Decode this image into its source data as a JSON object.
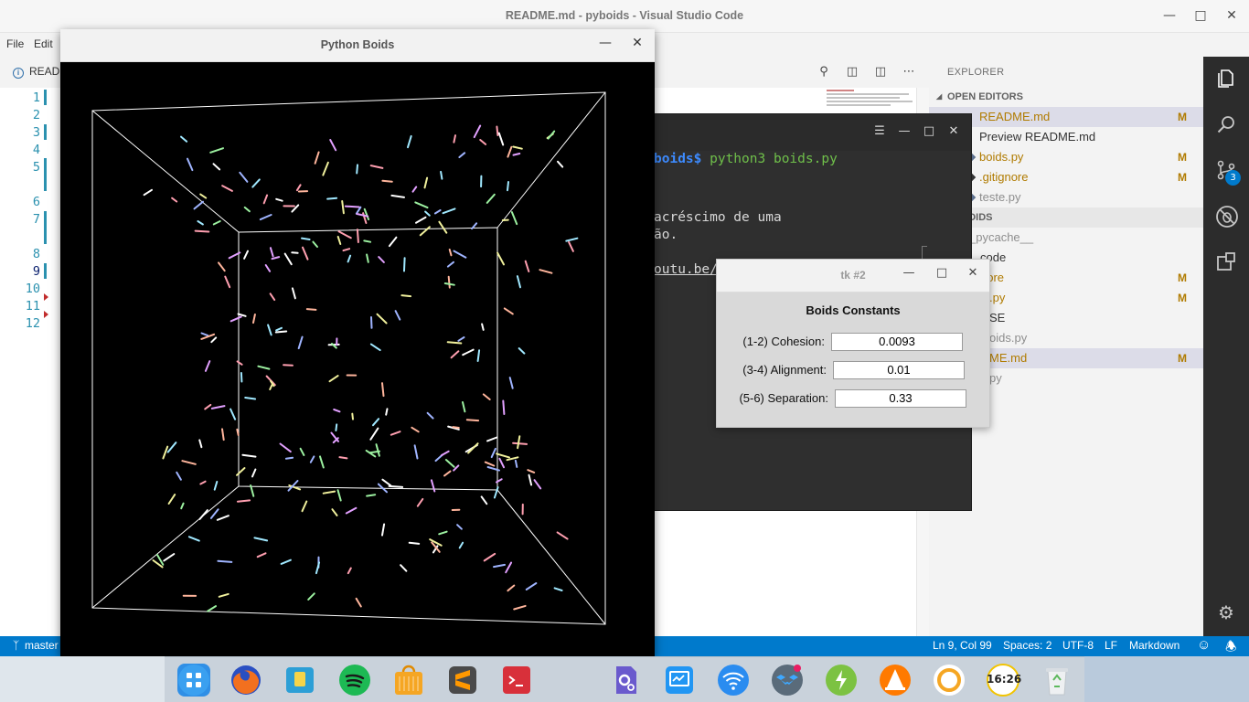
{
  "vscode": {
    "title": "README.md - pyboids - Visual Studio Code",
    "menu": [
      "File",
      "Edit"
    ],
    "tab_label": "READ",
    "line_numbers": [
      "1",
      "2",
      "3",
      "4",
      "5",
      "6",
      "7",
      "8",
      "9",
      "10",
      "11",
      "12"
    ],
    "explorer": {
      "title": "EXPLORER",
      "open_editors_header": "OPEN EDITORS",
      "open_editors": [
        {
          "name": "README.md",
          "badge": "M"
        },
        {
          "name": "Preview README.md",
          "badge": ""
        },
        {
          "name": "boids.py",
          "badge": "M"
        },
        {
          "name": ".gitignore",
          "badge": "M"
        },
        {
          "name": "teste.py",
          "badge": ""
        }
      ],
      "project_header": "PYBOIDS",
      "project_items": [
        {
          "name": "_pycache__",
          "badge": ""
        },
        {
          "name": "code",
          "badge": ""
        },
        {
          "name": "nore",
          "badge": "M"
        },
        {
          "name": ".py",
          "badge": "M"
        },
        {
          "name": "SE",
          "badge": ""
        },
        {
          "name": "oids.py",
          "badge": ""
        },
        {
          "name": "ME.md",
          "badge": "M"
        },
        {
          "name": "py",
          "badge": ""
        }
      ]
    },
    "scm_badge": "3",
    "statusbar": {
      "branch": "master",
      "position": "Ln 9, Col 99",
      "spaces": "Spaces: 2",
      "encoding": "UTF-8",
      "eol": "LF",
      "language": "Markdown"
    }
  },
  "terminal": {
    "prompt": "boids$",
    "command": " python3 boids.py",
    "lines": [
      "acréscimo de uma",
      "ão.",
      "outu.be/"
    ]
  },
  "tk_dialog": {
    "title": "tk #2",
    "heading": "Boids Constants",
    "fields": [
      {
        "label": "(1-2) Cohesion:",
        "value": "0.0093"
      },
      {
        "label": "(3-4) Alignment:",
        "value": "0.01"
      },
      {
        "label": "(5-6) Separation:",
        "value": "0.33"
      }
    ]
  },
  "boids_window": {
    "title": "Python Boids"
  },
  "dock": {
    "icons": [
      "launcher-icon",
      "firefox-icon",
      "file-manager-icon",
      "spotify-icon",
      "store-icon",
      "sublime-text-icon",
      "terminal-icon",
      "settings-icon",
      "monitor-icon",
      "wifi-icon",
      "dropbox-icon",
      "power-icon",
      "vlc-icon",
      "browser-icon",
      "clock-icon",
      "trash-icon"
    ],
    "clock_text": "16:26"
  }
}
